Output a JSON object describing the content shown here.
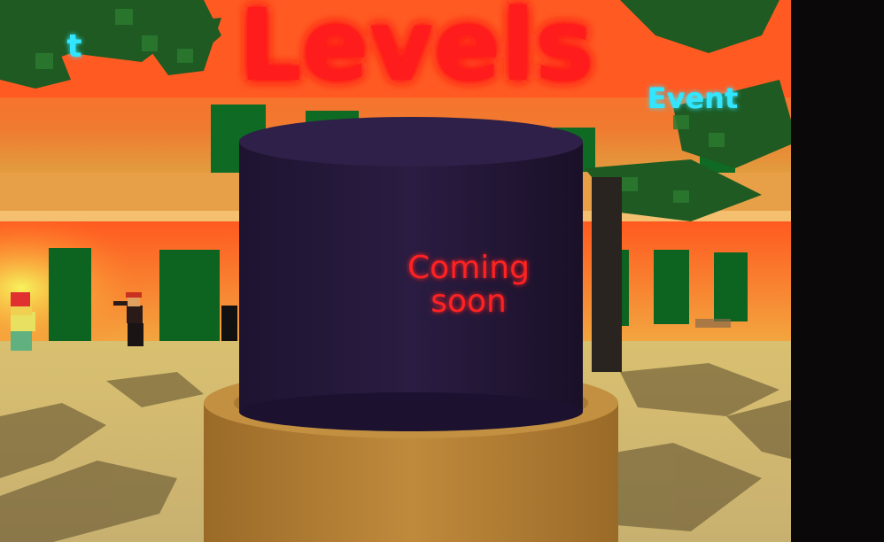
{
  "scene": {
    "main_sign": "Levels",
    "event_sign": "Event",
    "partial_sign": "t",
    "pillar_label_line1": "Coming",
    "pillar_label_line2": "soon"
  },
  "colors": {
    "sky": "#3ad0e0",
    "wall_glow": "#ff5a20",
    "sign_red": "#ff1a1a",
    "sign_cyan": "#33e6ff",
    "pillar": "#24183a",
    "pedestal": "#b8843a",
    "sand": "#d9c68a",
    "door_green": "#0f6a24",
    "leaf_green": "#1f5a22"
  }
}
